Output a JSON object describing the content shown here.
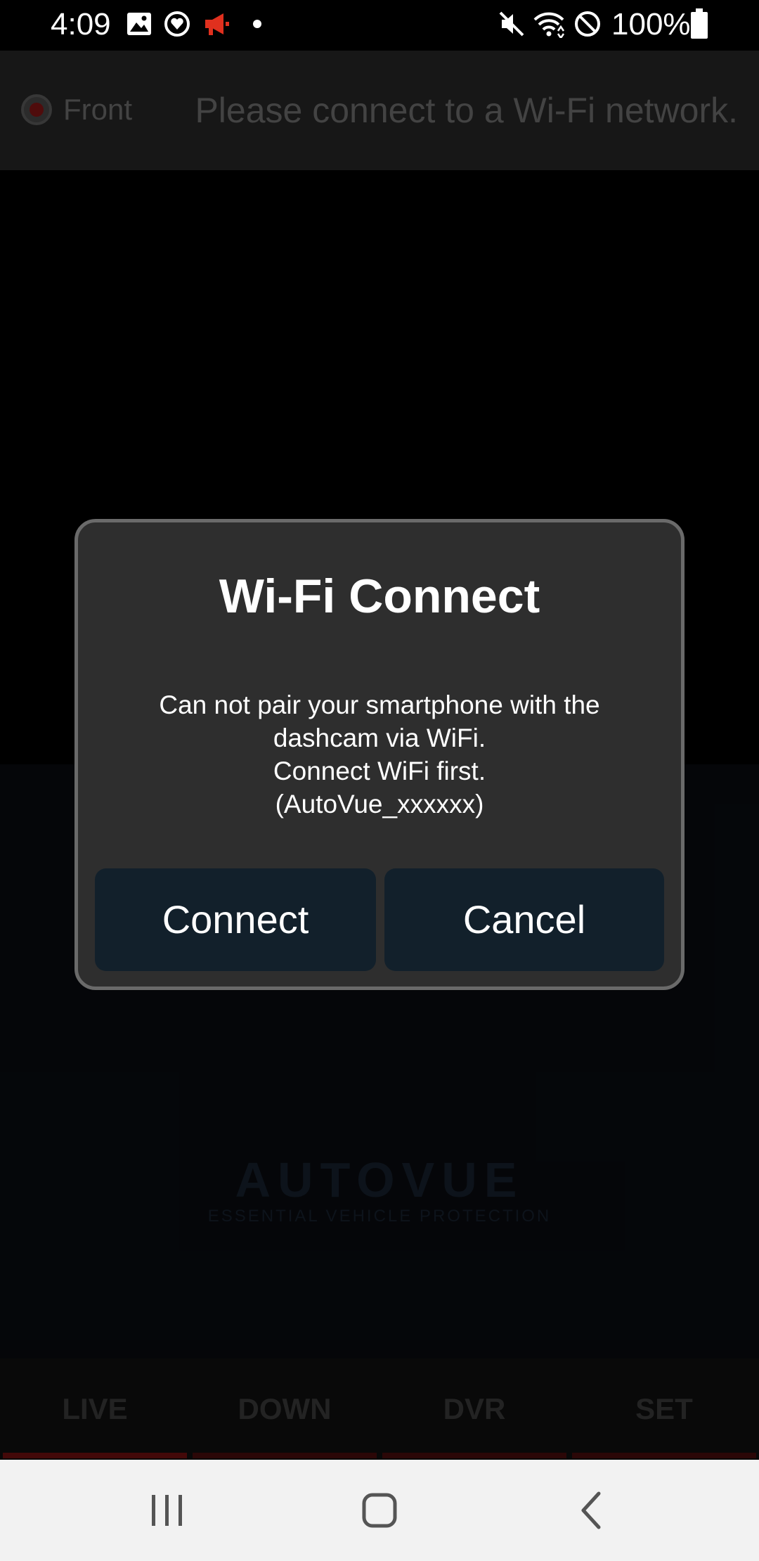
{
  "status_bar": {
    "time": "4:09",
    "battery": "100%",
    "icons": [
      "gallery-icon",
      "heart-circle-icon",
      "megaphone-icon",
      "dot-icon",
      "mute-icon",
      "wifi-icon",
      "do-not-disturb-icon",
      "battery-icon"
    ],
    "colors": {
      "megaphone": "#e0301e"
    }
  },
  "header": {
    "camera_label": "Front",
    "connection_message": "Please connect to a Wi-Fi network."
  },
  "logo": {
    "brand": "AUTOVUE",
    "tagline": "ESSENTIAL VEHICLE PROTECTION"
  },
  "tabs": [
    {
      "label": "LIVE",
      "active": true
    },
    {
      "label": "DOWN",
      "active": false
    },
    {
      "label": "DVR",
      "active": false
    },
    {
      "label": "SET",
      "active": false
    }
  ],
  "dialog": {
    "title": "Wi-Fi Connect",
    "message_lines": [
      "Can not pair your smartphone with the",
      "dashcam via WiFi.",
      "Connect WiFi first.",
      "(AutoVue_xxxxxx)"
    ],
    "connect_label": "Connect",
    "cancel_label": "Cancel"
  },
  "nav_bar": {
    "icons": [
      "recent-apps-icon",
      "home-icon",
      "back-icon"
    ]
  }
}
